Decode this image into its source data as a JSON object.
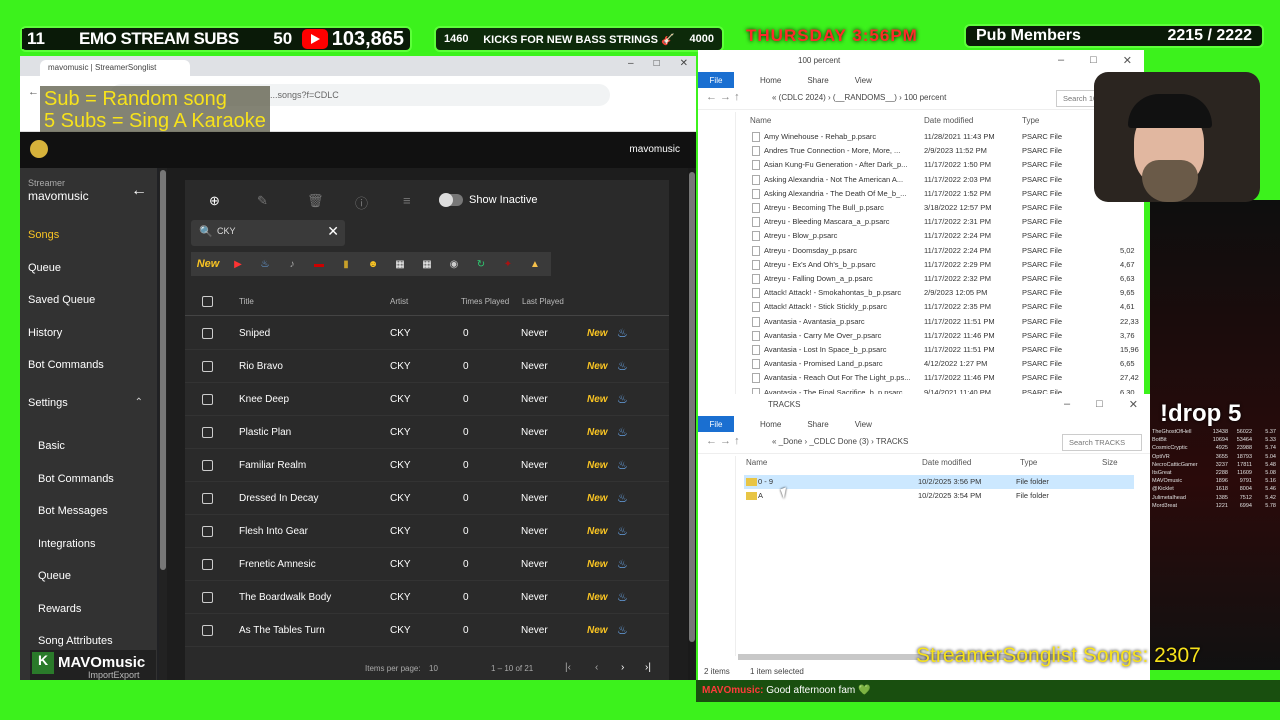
{
  "topbar": {
    "sub_goal_current": "11",
    "sub_goal_title": "EMO STREAM SUBS",
    "sub_goal_target": "50",
    "youtube_subs": "103,865",
    "kicks_count": "1460",
    "kicks_title": "KICKS FOR NEW BASS STRINGS 🎸",
    "kicks_target": "4000",
    "day_time": "THURSDAY 3:56PM",
    "pub_label": "Pub Members",
    "pub_count": "2215 / 2222"
  },
  "overlay": {
    "line1": "Sub = Random song",
    "line2": "5 Subs = Sing A Karaoke"
  },
  "browser": {
    "tab_title": "mavomusic | StreamerSonglist",
    "url": "...songs?f=CDLC",
    "header_user": "mavomusic"
  },
  "sidebar": {
    "label": "Streamer",
    "name": "mavomusic",
    "items": [
      {
        "label": "Songs"
      },
      {
        "label": "Queue"
      },
      {
        "label": "Saved Queue"
      },
      {
        "label": "History"
      },
      {
        "label": "Bot Commands"
      },
      {
        "label": "Settings"
      }
    ],
    "settings_items": [
      {
        "label": "Basic"
      },
      {
        "label": "Bot Commands"
      },
      {
        "label": "Bot Messages"
      },
      {
        "label": "Integrations"
      },
      {
        "label": "Queue"
      },
      {
        "label": "Rewards"
      },
      {
        "label": "Song Attributes"
      }
    ]
  },
  "toolbar": {
    "show_inactive_label": "Show Inactive"
  },
  "search": {
    "value": "CKY"
  },
  "tags": {
    "new_label": "New"
  },
  "table": {
    "columns": [
      "Title",
      "Artist",
      "Times Played",
      "Last Played"
    ],
    "rows": [
      {
        "title": "Sniped",
        "artist": "CKY",
        "plays": "0",
        "last": "Never",
        "tag": "New"
      },
      {
        "title": "Rio Bravo",
        "artist": "CKY",
        "plays": "0",
        "last": "Never",
        "tag": "New"
      },
      {
        "title": "Knee Deep",
        "artist": "CKY",
        "plays": "0",
        "last": "Never",
        "tag": "New"
      },
      {
        "title": "Plastic Plan",
        "artist": "CKY",
        "plays": "0",
        "last": "Never",
        "tag": "New"
      },
      {
        "title": "Familiar Realm",
        "artist": "CKY",
        "plays": "0",
        "last": "Never",
        "tag": "New"
      },
      {
        "title": "Dressed In Decay",
        "artist": "CKY",
        "plays": "0",
        "last": "Never",
        "tag": "New"
      },
      {
        "title": "Flesh Into Gear",
        "artist": "CKY",
        "plays": "0",
        "last": "Never",
        "tag": "New"
      },
      {
        "title": "Frenetic Amnesic",
        "artist": "CKY",
        "plays": "0",
        "last": "Never",
        "tag": "New"
      },
      {
        "title": "The Boardwalk Body",
        "artist": "CKY",
        "plays": "0",
        "last": "Never",
        "tag": "New"
      },
      {
        "title": "As The Tables Turn",
        "artist": "CKY",
        "plays": "0",
        "last": "Never",
        "tag": "New"
      }
    ]
  },
  "pager": {
    "items_per_page_label": "Items per page:",
    "items_per_page": "10",
    "range": "1 – 10 of 21"
  },
  "mavo_badge": {
    "title": "MAVOmusic",
    "sub": "ImportExport"
  },
  "explorer1": {
    "title": "100 percent",
    "ribbon": [
      "File",
      "Home",
      "Share",
      "View"
    ],
    "breadcrumb": "« (CDLC 2024) › (__RANDOMS__) › 100 percent",
    "search_placeholder": "Search 100 p...",
    "columns": [
      "Name",
      "Date modified",
      "Type"
    ],
    "rows": [
      {
        "name": "Amy Winehouse - Rehab_p.psarc",
        "date": "11/28/2021 11:43 PM",
        "type": "PSARC File",
        "size": ""
      },
      {
        "name": "Andres True Connection - More, More, ...",
        "date": "2/9/2023 11:52 PM",
        "type": "PSARC File",
        "size": ""
      },
      {
        "name": "Asian Kung-Fu Generation - After Dark_p...",
        "date": "11/17/2022 1:50 PM",
        "type": "PSARC File",
        "size": ""
      },
      {
        "name": "Asking Alexandria - Not The American A...",
        "date": "11/17/2022 2:03 PM",
        "type": "PSARC File",
        "size": ""
      },
      {
        "name": "Asking Alexandria - The Death Of Me_b_...",
        "date": "11/17/2022 1:52 PM",
        "type": "PSARC File",
        "size": ""
      },
      {
        "name": "Atreyu - Becoming The Bull_p.psarc",
        "date": "3/18/2022 12:57 PM",
        "type": "PSARC File",
        "size": ""
      },
      {
        "name": "Atreyu - Bleeding Mascara_a_p.psarc",
        "date": "11/17/2022 2:31 PM",
        "type": "PSARC File",
        "size": ""
      },
      {
        "name": "Atreyu - Blow_p.psarc",
        "date": "11/17/2022 2:24 PM",
        "type": "PSARC File",
        "size": ""
      },
      {
        "name": "Atreyu - Doomsday_p.psarc",
        "date": "11/17/2022 2:24 PM",
        "type": "PSARC File",
        "size": "5,02"
      },
      {
        "name": "Atreyu - Ex's And Oh's_b_p.psarc",
        "date": "11/17/2022 2:29 PM",
        "type": "PSARC File",
        "size": "4,67"
      },
      {
        "name": "Atreyu - Falling Down_a_p.psarc",
        "date": "11/17/2022 2:32 PM",
        "type": "PSARC File",
        "size": "6,63"
      },
      {
        "name": "Attack! Attack! - Smokahontas_b_p.psarc",
        "date": "2/9/2023 12:05 PM",
        "type": "PSARC File",
        "size": "9,65"
      },
      {
        "name": "Attack! Attack! - Stick Stickly_p.psarc",
        "date": "11/17/2022 2:35 PM",
        "type": "PSARC File",
        "size": "4,61"
      },
      {
        "name": "Avantasia - Avantasia_p.psarc",
        "date": "11/17/2022 11:51 PM",
        "type": "PSARC File",
        "size": "22,33"
      },
      {
        "name": "Avantasia - Carry Me Over_p.psarc",
        "date": "11/17/2022 11:46 PM",
        "type": "PSARC File",
        "size": "3,76"
      },
      {
        "name": "Avantasia - Lost In Space_b_p.psarc",
        "date": "11/17/2022 11:51 PM",
        "type": "PSARC File",
        "size": "15,96"
      },
      {
        "name": "Avantasia - Promised Land_p.psarc",
        "date": "4/12/2022 1:27 PM",
        "type": "PSARC File",
        "size": "6,65"
      },
      {
        "name": "Avantasia - Reach Out For The Light_p.ps...",
        "date": "11/17/2022 11:46 PM",
        "type": "PSARC File",
        "size": "27,42"
      },
      {
        "name": "Avantasia - The Final Sacrifice_b_p.psarc",
        "date": "9/14/2021 11:40 PM",
        "type": "PSARC File",
        "size": "6,30"
      }
    ]
  },
  "explorer2": {
    "title": "TRACKS",
    "ribbon": [
      "File",
      "Home",
      "Share",
      "View"
    ],
    "breadcrumb": "« _Done › _CDLC Done (3) › TRACKS",
    "search_placeholder": "Search TRACKS",
    "columns": [
      "Name",
      "Date modified",
      "Type",
      "Size"
    ],
    "rows": [
      {
        "name": "0 - 9",
        "date": "10/2/2025 3:56 PM",
        "type": "File folder",
        "selected": true
      },
      {
        "name": "A",
        "date": "10/2/2025 3:54 PM",
        "type": "File folder",
        "selected": false
      }
    ],
    "status_items": "2 items",
    "status_selected": "1 item selected"
  },
  "right": {
    "drop_label": "!drop 5",
    "leaderboard": [
      [
        "TheGhostOfHell",
        "13438",
        "56022",
        "5.37"
      ],
      [
        "BotBit",
        "10694",
        "53464",
        "5.33"
      ],
      [
        "CosmicCryptic",
        "4925",
        "23988",
        "5.74"
      ],
      [
        "OptiVR",
        "3655",
        "18793",
        "5.04"
      ],
      [
        "NecroCatticGamer",
        "3237",
        "17811",
        "5.48"
      ],
      [
        "ItsGreat",
        "2288",
        "11609",
        "5.08"
      ],
      [
        "MAVOmusic",
        "1896",
        "9791",
        "5.16"
      ],
      [
        "@Kicklet",
        "1618",
        "8004",
        "5.46"
      ],
      [
        "Julimetalhead",
        "1385",
        "7512",
        "5.42"
      ],
      [
        "Mord3reat",
        "1221",
        "6994",
        "5.78"
      ]
    ],
    "songs_count_label": "StreamerSonglist Songs: 2307"
  },
  "chat": {
    "user": "MAVOmusic:",
    "message": "Good afternoon fam 💚"
  },
  "colors": {
    "bg_green": "#3cf21c",
    "accent_yellow": "#f9c423",
    "explorer_file_blue": "#1a6fd1"
  }
}
